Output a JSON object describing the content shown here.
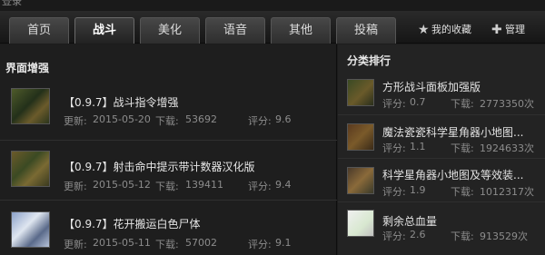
{
  "top": {
    "login_text": "登录"
  },
  "nav": {
    "tabs": [
      {
        "label": "首页"
      },
      {
        "label": "战斗"
      },
      {
        "label": "美化"
      },
      {
        "label": "语音"
      },
      {
        "label": "其他"
      },
      {
        "label": "投稿"
      }
    ],
    "active_tab": "战斗",
    "favorites_label": "我的收藏",
    "manage_label": "管理"
  },
  "left": {
    "title": "界面增强",
    "items": [
      {
        "title": "【0.9.7】战斗指令增强",
        "updated_label": "更新:",
        "updated": "2015-05-20",
        "downloads_label": "下载:",
        "downloads": "53692",
        "rating_label": "评分:",
        "rating": "9.6"
      },
      {
        "title": "【0.9.7】射击命中提示带计数器汉化版",
        "updated_label": "更新:",
        "updated": "2015-05-12",
        "downloads_label": "下载:",
        "downloads": "139411",
        "rating_label": "评分:",
        "rating": "9.4"
      },
      {
        "title": "【0.9.7】花开搬运白色尸体",
        "updated_label": "更新:",
        "updated": "2015-05-11",
        "downloads_label": "下载:",
        "downloads": "57002",
        "rating_label": "评分:",
        "rating": "9.1"
      }
    ]
  },
  "right": {
    "title": "分类排行",
    "items": [
      {
        "title": "方形战斗面板加强版",
        "rating_label": "评分:",
        "rating": "0.7",
        "downloads_label": "下载:",
        "downloads": "2773350次"
      },
      {
        "title": "魔法瓷瓷科学星角器小地图...",
        "rating_label": "评分:",
        "rating": "1.1",
        "downloads_label": "下载:",
        "downloads": "1924633次"
      },
      {
        "title": "科学星角器小地图及等效装...",
        "rating_label": "评分:",
        "rating": "1.9",
        "downloads_label": "下载:",
        "downloads": "1012317次"
      },
      {
        "title": "剩余总血量",
        "rating_label": "评分:",
        "rating": "2.6",
        "downloads_label": "下载:",
        "downloads": "913529次"
      }
    ]
  }
}
